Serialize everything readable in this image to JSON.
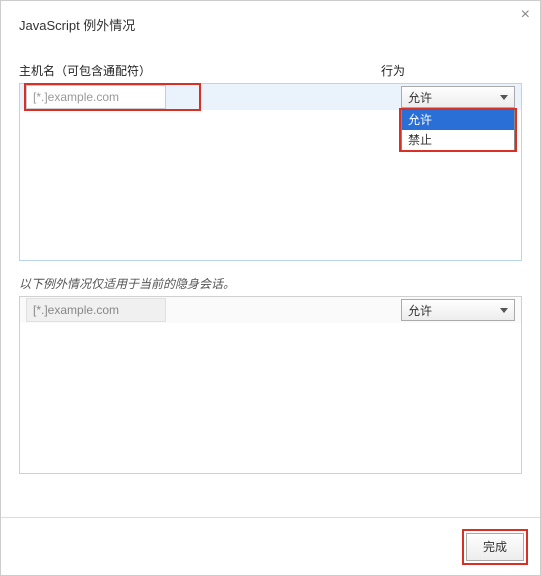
{
  "dialog": {
    "title": "JavaScript 例外情况",
    "close": "×"
  },
  "headers": {
    "hostname": "主机名（可包含通配符）",
    "action": "行为"
  },
  "main": {
    "input_placeholder": "[*.]example.com",
    "dropdown_value": "允许",
    "dropdown_options": [
      "允许",
      "禁止"
    ]
  },
  "note": "以下例外情况仅适用于当前的隐身会话。",
  "secondary": {
    "input_placeholder": "[*.]example.com",
    "dropdown_value": "允许"
  },
  "footer": {
    "done": "完成"
  }
}
